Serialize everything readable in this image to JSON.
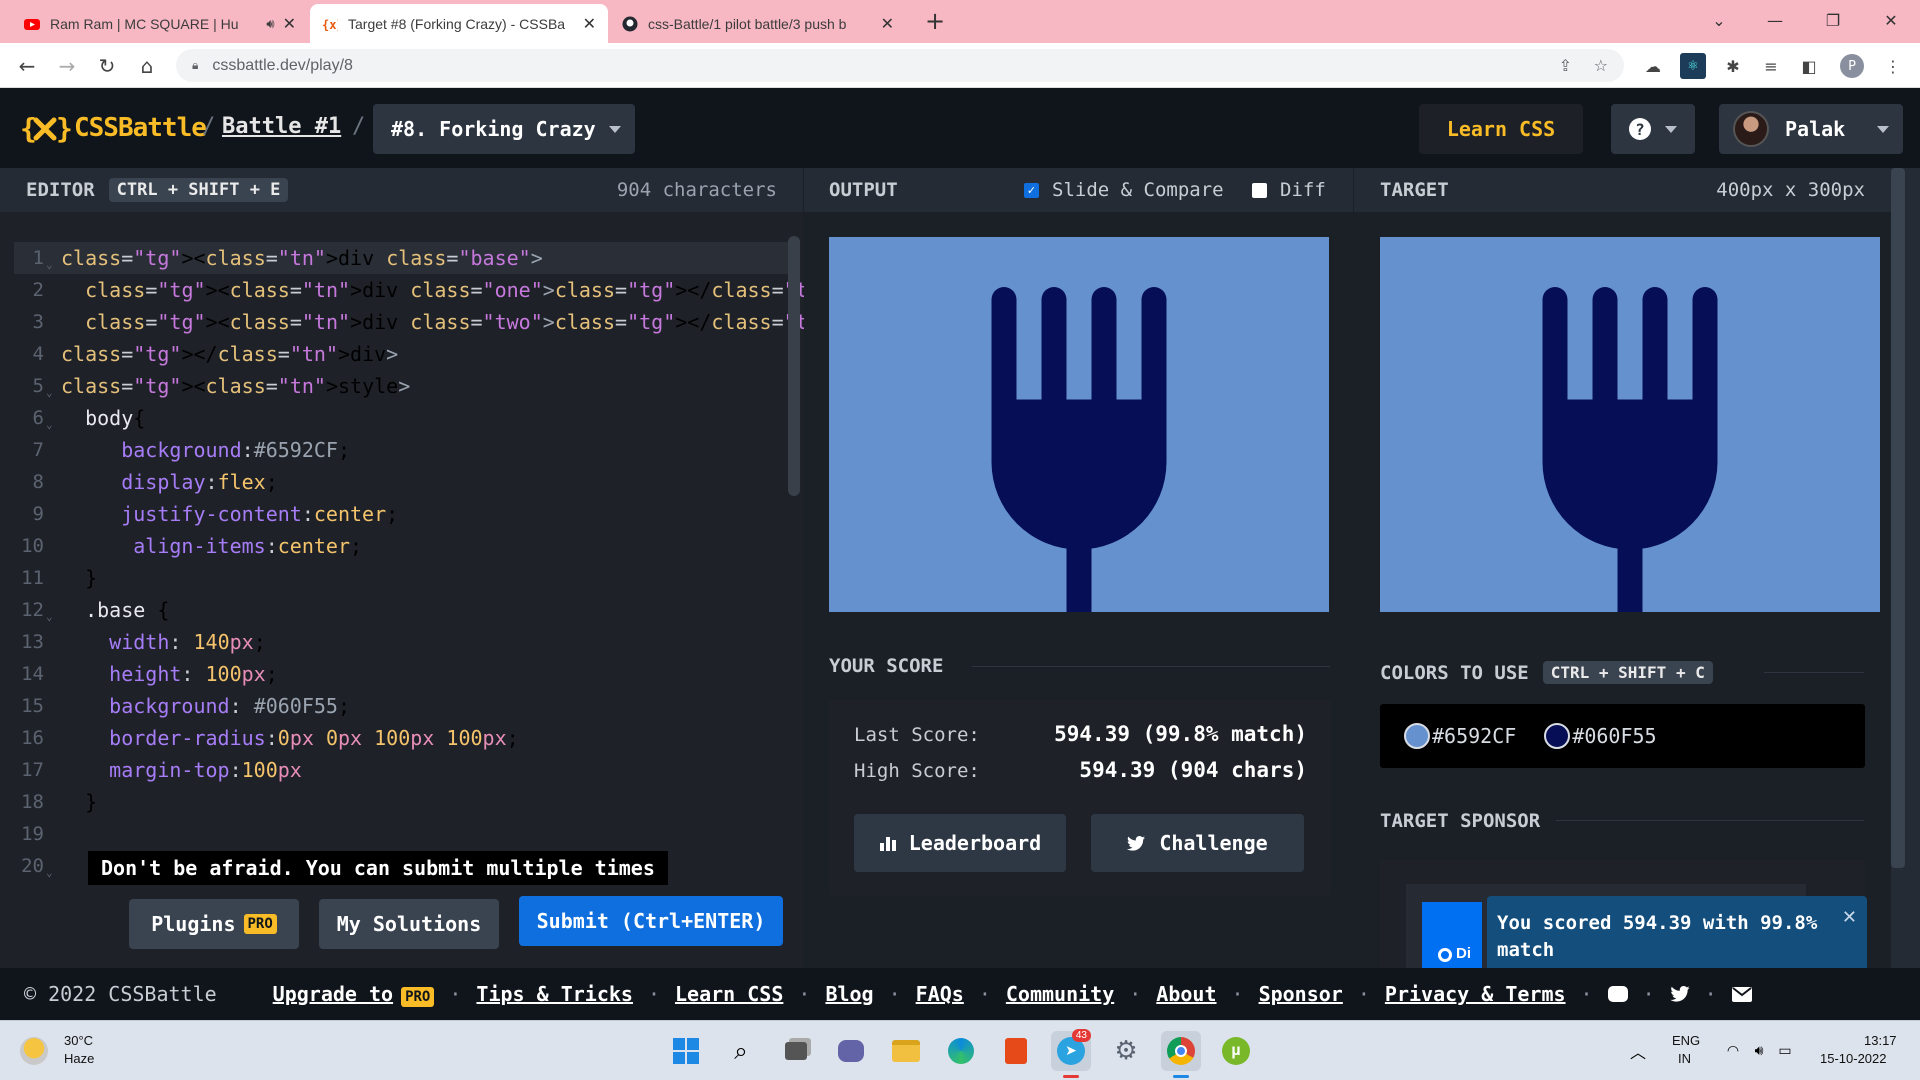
{
  "browser": {
    "tabs": [
      {
        "title": "Ram Ram | MC SQUARE | Hu",
        "has_audio": true
      },
      {
        "title": "Target #8 (Forking Crazy) - CSSBa",
        "active": true
      },
      {
        "title": "css-Battle/1 pilot battle/3 push b"
      }
    ],
    "new_tab": "+",
    "url": "cssbattle.dev/play/8",
    "profile_initial": "P"
  },
  "header": {
    "brand": "CSSBattle",
    "battle": "Battle #1",
    "separator": "/",
    "level": "#8. Forking Crazy",
    "learn": "Learn CSS",
    "help": "?",
    "user": "Palak"
  },
  "editor": {
    "title": "EDITOR",
    "shortcut": "CTRL + SHIFT + E",
    "char_count": "904 characters",
    "lines": [
      {
        "n": "1",
        "text": "<div class=\"base\">"
      },
      {
        "n": "2",
        "text": "  <div class=\"one\"></div>"
      },
      {
        "n": "3",
        "text": "  <div class=\"two\"></div>"
      },
      {
        "n": "4",
        "text": "</div>"
      },
      {
        "n": "5",
        "text": "<style>"
      },
      {
        "n": "6",
        "text": "  body{"
      },
      {
        "n": "7",
        "text": "     background:#6592CF;"
      },
      {
        "n": "8",
        "text": "     display:flex;"
      },
      {
        "n": "9",
        "text": "     justify-content:center;"
      },
      {
        "n": "10",
        "text": "      align-items:center;"
      },
      {
        "n": "11",
        "text": "  }"
      },
      {
        "n": "12",
        "text": "  .base {"
      },
      {
        "n": "13",
        "text": "    width: 140px;"
      },
      {
        "n": "14",
        "text": "    height: 100px;"
      },
      {
        "n": "15",
        "text": "    background: #060F55;"
      },
      {
        "n": "16",
        "text": "    border-radius:0px 0px 100px 100px;"
      },
      {
        "n": "17",
        "text": "    margin-top:100px"
      },
      {
        "n": "18",
        "text": "  }"
      },
      {
        "n": "19",
        "text": ""
      },
      {
        "n": "20",
        "text": ""
      }
    ],
    "tooltip": "Don't be afraid. You can submit multiple times",
    "plugins": "Plugins",
    "pro_badge": "PRO",
    "my_solutions": "My Solutions",
    "submit": "Submit (Ctrl+ENTER)"
  },
  "output": {
    "title": "OUTPUT",
    "slide_compare": "Slide & Compare",
    "slide_compare_checked": true,
    "diff": "Diff",
    "diff_checked": false
  },
  "target": {
    "title": "TARGET",
    "dimensions": "400px x 300px"
  },
  "score": {
    "title": "YOUR SCORE",
    "last_label": "Last Score:",
    "last_value": "594.39 (99.8% match)",
    "high_label": "High Score:",
    "high_value": "594.39 (904 chars)",
    "leaderboard": "Leaderboard",
    "challenge": "Challenge"
  },
  "colors": {
    "title": "COLORS TO USE",
    "shortcut": "CTRL + SHIFT + C",
    "items": [
      {
        "hex": "#6592CF"
      },
      {
        "hex": "#060F55"
      }
    ]
  },
  "sponsor": {
    "title": "TARGET SPONSOR",
    "partial_text": "Di"
  },
  "toast": {
    "message": "You scored 594.39 with 99.8% match",
    "close": "✕"
  },
  "footer": {
    "copyright": "© 2022 CSSBattle",
    "links": [
      "Upgrade to",
      "Tips & Tricks",
      "Learn CSS",
      "Blog",
      "FAQs",
      "Community",
      "About",
      "Sponsor",
      "Privacy & Terms"
    ],
    "pro_badge": "PRO",
    "separator": "·"
  },
  "taskbar": {
    "weather_temp": "30°C",
    "weather_desc": "Haze",
    "telegram_badge": "43",
    "lang": "ENG",
    "region": "IN",
    "time": "13:17",
    "date": "15-10-2022"
  },
  "palette": {
    "canvas_bg": "#6592CF",
    "fork": "#060F55",
    "brand": "#f9bc26",
    "submit": "#0f6fde"
  }
}
